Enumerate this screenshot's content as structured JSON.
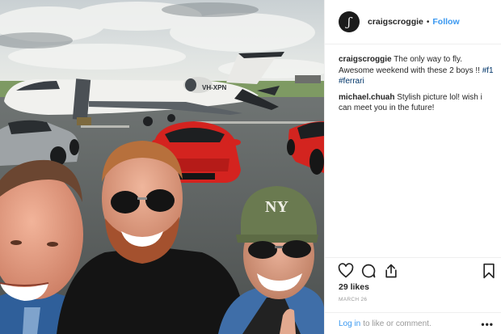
{
  "post": {
    "photo": {
      "scene": "selfie-at-airfield",
      "aircraft_tail": "VH-XPN"
    },
    "header": {
      "username": "craigscroggie",
      "separator": "•",
      "follow_label": "Follow"
    },
    "comments": [
      {
        "username": "craigscroggie",
        "text": "The only way to fly. Awesome weekend with these 2 boys !! ",
        "hashtags": [
          "#f1",
          "#ferrari"
        ]
      },
      {
        "username": "michael.chuah",
        "text": "Stylish picture lol! wish i can meet you in the future!"
      }
    ],
    "actions": {
      "like_icon": "heart-icon",
      "comment_icon": "comment-bubble-icon",
      "share_icon": "share-icon",
      "save_icon": "bookmark-icon"
    },
    "likes_label": "29 likes",
    "date_label": "MARCH 26",
    "login": {
      "link_label": "Log in",
      "rest_label": "to like or comment.",
      "more_label": "•••"
    }
  },
  "colors": {
    "link": "#3897f0",
    "hashtag": "#003569",
    "text": "#262626",
    "muted": "#999999",
    "divider": "#efefef"
  }
}
